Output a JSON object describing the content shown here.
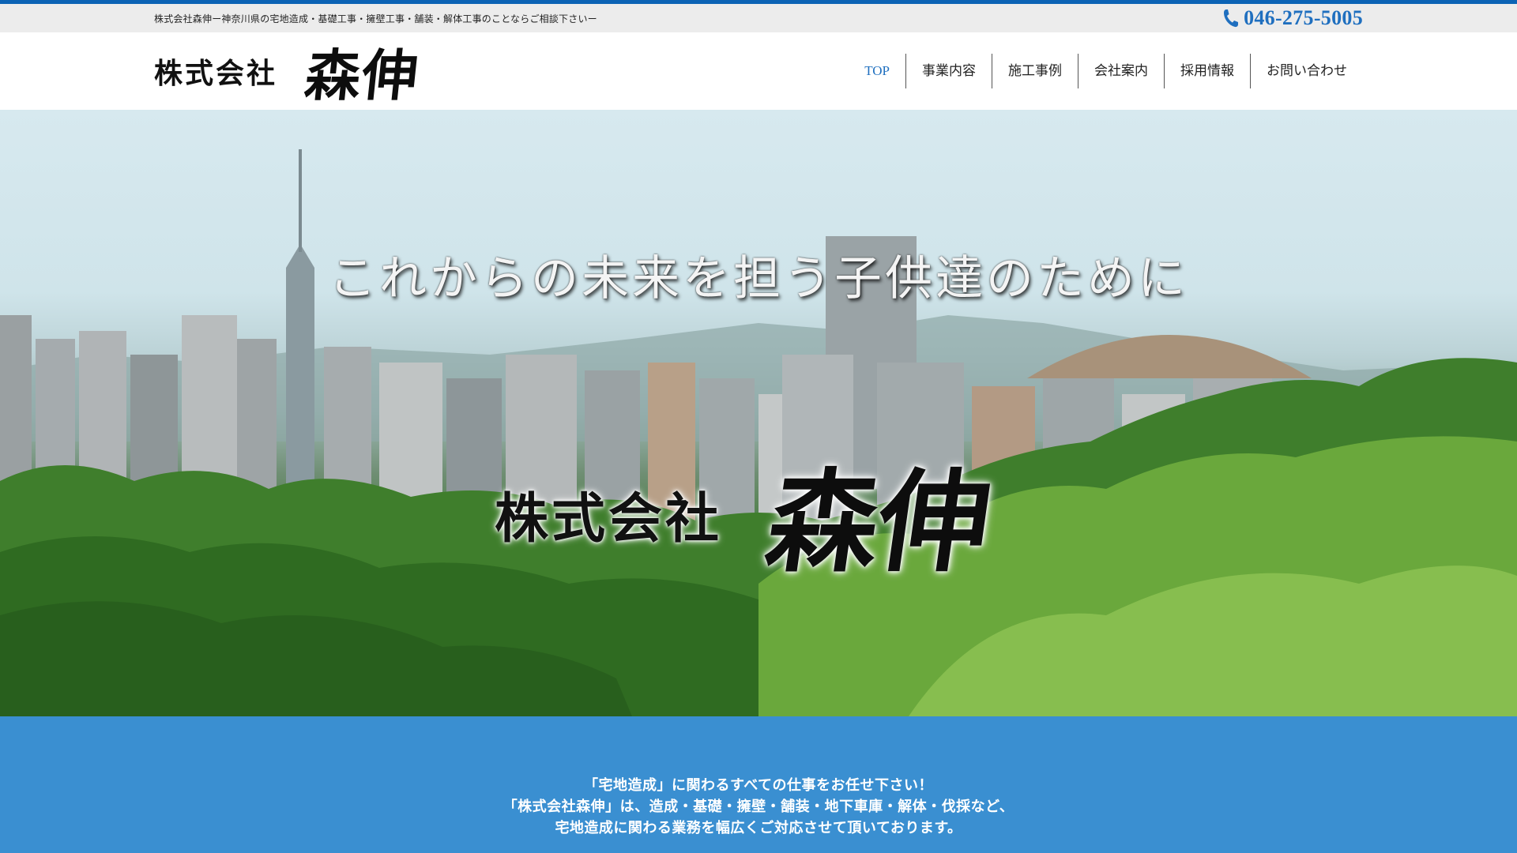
{
  "topbar": {
    "tagline": "株式会社森伸ー神奈川県の宅地造成・基礎工事・擁壁工事・舗装・解体工事のことならご相談下さいー",
    "phone": "046-275-5005"
  },
  "logo": {
    "prefix": "株式会社",
    "name": "森伸"
  },
  "nav": [
    {
      "label": "TOP"
    },
    {
      "label": "事業内容"
    },
    {
      "label": "施工事例"
    },
    {
      "label": "会社案内"
    },
    {
      "label": "採用情報"
    },
    {
      "label": "お問い合わせ"
    }
  ],
  "hero": {
    "catch": "これからの未来を担う子供達のために",
    "logo_prefix": "株式会社",
    "logo_name": "森伸"
  },
  "intro": {
    "line1": "「宅地造成」に関わるすべての仕事をお任せ下さい！",
    "line2": "「株式会社森伸」は、造成・基礎・擁壁・舗装・地下車庫・解体・伐採など、",
    "line3": "宅地造成に関わる業務を幅広くご対応させて頂いております。"
  },
  "colors": {
    "accent": "#1f6fbf",
    "top_border": "#0b63b5",
    "intro_bg": "#3a8fd1",
    "topbar_bg": "#ececec"
  },
  "icons": {
    "phone": "phone-icon"
  }
}
